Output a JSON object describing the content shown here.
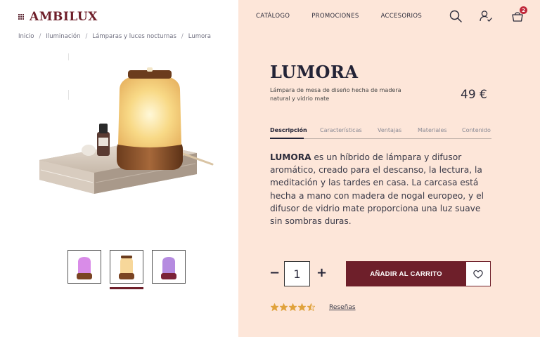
{
  "brand": {
    "name": "AMBILUX"
  },
  "breadcrumb": [
    "Inicio",
    "Iluminación",
    "Lámparas y luces nocturnas",
    "Lumora"
  ],
  "breadcrumb_separator": "/",
  "nav": {
    "items": [
      "CATÁLOGO",
      "PROMOCIONES",
      "ACCESORIOS"
    ]
  },
  "header_icons": {
    "search": "search-icon",
    "account": "user-check-icon",
    "cart": "basket-icon",
    "cart_count": "2"
  },
  "product": {
    "name": "LUMORA",
    "subtitle": "Lámpara de mesa de diseño hecha de madera natural y vidrio mate",
    "price": "49 €",
    "tabs": [
      "Descripción",
      "Características",
      "Ventajas",
      "Materiales",
      "Contenido"
    ],
    "active_tab": "Descripción",
    "description_lead": "LUMORA",
    "description_body": " es un híbrido de lámpara y difusor aromático, creado para el descanso, la lectura, la meditación y las tardes en casa. La carcasa está hecha a mano con madera de nogal europeo, y el difusor de vidrio mate proporciona una luz suave sin sombras duras.",
    "quantity": "1",
    "add_to_cart": "AÑADIR AL CARRITO",
    "rating": 4.5,
    "rating_max": 5,
    "reviews_label": "Reseñas"
  },
  "thumbnails": [
    {
      "variant": "violeta",
      "glow": "#d98ce8"
    },
    {
      "variant": "ámbar",
      "glow": "#f7d79a",
      "selected": true
    },
    {
      "variant": "lila",
      "glow": "#b58be0"
    }
  ],
  "colors": {
    "brand": "#6e1f2a",
    "panel": "#fde6d9",
    "star": "#e0a23c",
    "badge": "#c0283a"
  },
  "quantity_controls": {
    "minus": "−",
    "plus": "+"
  }
}
